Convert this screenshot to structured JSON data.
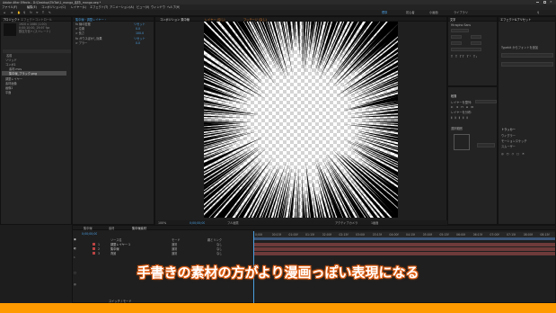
{
  "window": {
    "title": "Adobe After Effects - D:\\Desktop\\TikTok\\1_manga_素材\\_manga.aep *"
  },
  "menu": [
    "ファイル(F)",
    "編集(E)",
    "コンポジション(C)",
    "レイヤー(L)",
    "エフェクト(T)",
    "アニメーション(A)",
    "ビュー(V)",
    "ウィンドウ",
    "ヘルプ(H)"
  ],
  "toolbar": {
    "workspaces": [
      "標準",
      "初心者",
      "小画面",
      "ライブラリ"
    ]
  },
  "project": {
    "tabs": [
      "プロジェクト",
      "エフェクトコントロール"
    ],
    "info_line1": "1920 x 1080 (1.00)",
    "info_line2": "0;00;10;00, 29.97 fps",
    "info_line3": "数百万色+ (ストレート)",
    "column_name": "名前",
    "items": [
      "ソリッド",
      "コンポ1",
      "素材.mov",
      "集中線_ブラック.png",
      "調整レイヤー",
      "素材画像",
      "画像2",
      "平面"
    ]
  },
  "effects": {
    "header": "集中線・調整レイヤー・",
    "rows": [
      {
        "label": "fx  線の密度",
        "value": "リセット"
      },
      {
        "label": "  > 位置",
        "value": "0.0"
      },
      {
        "label": "  > 長さ",
        "value": "100.0"
      },
      {
        "label": "fx  ガウスぼかし効果",
        "value": "リセット"
      },
      {
        "label": "  > ブラー",
        "value": "0.0"
      }
    ]
  },
  "viewer": {
    "tabs": [
      "コンポジション 集中線",
      "レイヤー (なし)",
      "フッテージ (なし)"
    ],
    "zoom": "100%",
    "timecode": "0;00;00;00",
    "resolution": "フル画質",
    "camera": "アクティブカメラ",
    "view": "1画面"
  },
  "right": {
    "tabs": [
      "情報",
      "オーディオ",
      "プレビュー"
    ],
    "character_title": "文字",
    "font": "Hiragino Sans",
    "paragraph_title": "段落",
    "align_title": "整列",
    "align_to": "レイヤーを整列:",
    "distribute": "レイヤーを分布:",
    "selection": "選択範囲",
    "fx_title": "エフェクト&プリセット",
    "fx_search": "",
    "typekit": "Typekit からフォントを追加",
    "tracker_title": "トラッカー",
    "wiggler": "ウィグラー",
    "motion_sketch": "モーションスケッチ",
    "smoother": "スムーザー"
  },
  "timeline": {
    "tabs": [
      "集中線",
      "素材",
      "集中線素材"
    ],
    "timecode": "0;00;00;00",
    "col_source": "ソース名",
    "col_mode": "モード",
    "col_parent": "親とリンク",
    "layers": [
      {
        "num": "1",
        "name": "調整レイヤー 1",
        "mode": "通常",
        "parent": "なし"
      },
      {
        "num": "2",
        "name": "集中線",
        "mode": "通常",
        "parent": "なし"
      },
      {
        "num": "3",
        "name": "背景",
        "mode": "通常",
        "parent": "なし"
      }
    ],
    "ruler": [
      "0;00f",
      "00:15f",
      "01:00f",
      "01:15f",
      "02:00f",
      "02:15f",
      "03:00f",
      "03:15f",
      "04:00f",
      "04:15f",
      "05:00f",
      "05:15f",
      "06:00f",
      "06:15f",
      "07:00f",
      "07:15f",
      "08:00f",
      "08:15f"
    ],
    "footer": "スイッチ / モード"
  },
  "caption": "手書きの素材の方がより漫画っぽい表現になる",
  "colors": {
    "accent": "#4a9fe0",
    "caption_stroke": "#e05f13",
    "bottom_bar": "#ff9a00",
    "layer_bar": "#6e3a3a"
  }
}
